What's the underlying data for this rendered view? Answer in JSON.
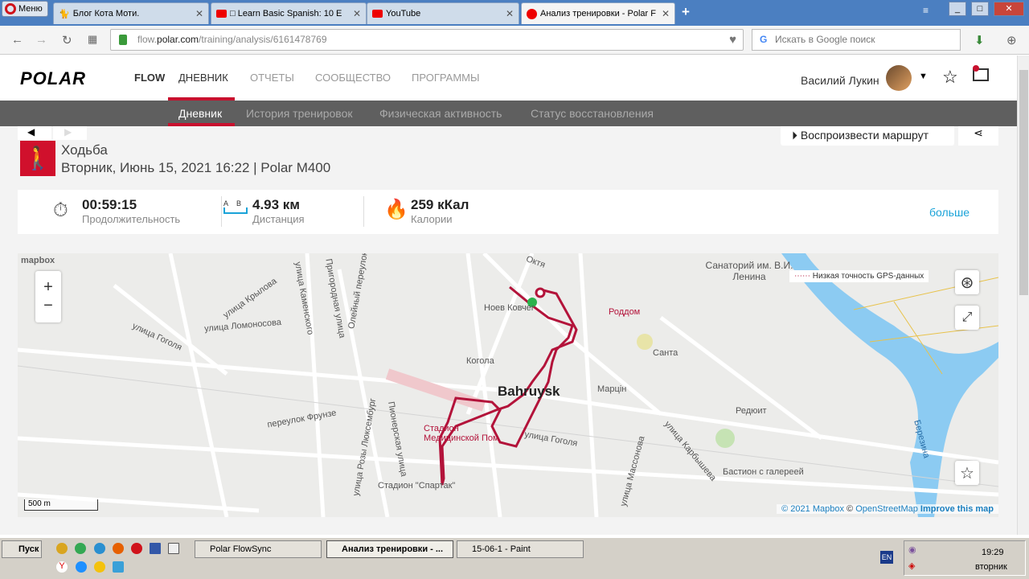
{
  "browser": {
    "menu_label": "Меню",
    "tabs": [
      {
        "title": "Блог Кота Моти."
      },
      {
        "title": "□ Learn Basic Spanish: 10 E"
      },
      {
        "title": "YouTube"
      },
      {
        "title": "Анализ тренировки - Polar F"
      }
    ],
    "url_domain": "flow.polar.com",
    "url_prefix": "flow.",
    "url_host": "polar.com",
    "url_path": "/training/analysis/6161478769",
    "search_placeholder": "Искать в Google поиск"
  },
  "site": {
    "logo": "POLAR",
    "flow": "FLOW",
    "nav": [
      "ДНЕВНИК",
      "ОТЧЕТЫ",
      "СООБЩЕСТВО",
      "ПРОГРАММЫ"
    ],
    "user": "Василий Лукин",
    "subnav": [
      "Дневник",
      "История тренировок",
      "Физическая активность",
      "Статус восстановления"
    ]
  },
  "training": {
    "sport": "Ходьба",
    "date": "Вторник, Июнь 15, 2021 16:22 | Polar M400",
    "replay_label": "Воспроизвести маршрут",
    "stats": [
      {
        "value": "00:59:15",
        "label": "Продолжительность"
      },
      {
        "value": "4.93 км",
        "label": "Дистанция",
        "ab": [
          "A",
          "B"
        ]
      },
      {
        "value": "259 кКал",
        "label": "Калории"
      }
    ],
    "more": "больше"
  },
  "map": {
    "brand": "mapbox",
    "gps_legend": "Низкая точность GPS-данных",
    "scale": "500 m",
    "attribution": [
      "© 2021 Mapbox",
      "©",
      "OpenStreetMap",
      "Improve this map"
    ],
    "labels": [
      "улица Крылова",
      "улица Ломоносова",
      "улица Гоголя",
      "улица Каменского",
      "Пригородная улица",
      "Олейный переулок",
      "Ноев Ковчег",
      "Когола",
      "Bahruysk",
      "Марцін",
      "Санта",
      "Роддом",
      "Санаторий им. В.И. Ленина",
      "Редюит",
      "Бастион с галереей",
      "Стадион \"Спартак\"",
      "переулок Фрунзе",
      "улица Розы Люксембург",
      "Пионерская улица",
      "улица Гоголя",
      "улица Массонова",
      "улица Карбышева",
      "Березина",
      "Стадион Медицинской Пом",
      "Октя"
    ]
  },
  "taskbar": {
    "start": "Пуск",
    "windows": [
      "Polar FlowSync",
      "Анализ тренировки - ...",
      "15-06-1 - Paint"
    ],
    "lang": "EN",
    "time": "19:29",
    "day": "вторник"
  }
}
